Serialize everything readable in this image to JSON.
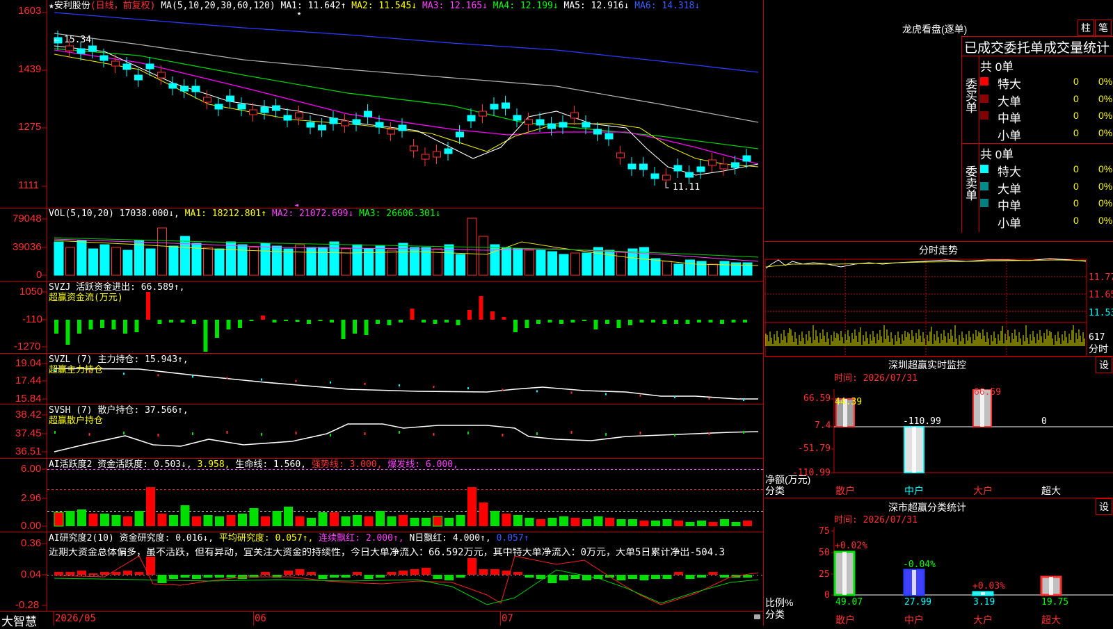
{
  "header": {
    "stock": "★安利股份",
    "period": "(日线，前复权)",
    "ma_params": "MA(5,10,20,30,60,120)",
    "ma1": "MA1: 11.642↑",
    "ma2": "MA2: 11.545↓",
    "ma3": "MA3: 12.165↓",
    "ma4": "MA4: 12.199↓",
    "ma5": "MA5: 12.916↓",
    "ma6": "MA6: 14.318↓"
  },
  "price_axis": [
    "1603",
    "1439",
    "1275",
    "1111"
  ],
  "price_annotations": {
    "high": "15.34",
    "low": "11.11"
  },
  "vol": {
    "name": "VOL(5,10,20)",
    "value": "17038.000↓,",
    "ma1": "MA1: 18212.801↑",
    "ma2": "MA2: 21072.699↓",
    "ma3": "MA3: 26606.301↓",
    "axis": [
      "79048",
      "39036",
      "0"
    ]
  },
  "svzj": {
    "title": "SVZJ  活跃资金进出: 66.589↑,",
    "subtitle": "超赢资金流(万元)",
    "axis": [
      "1050",
      "-110",
      "-1270"
    ]
  },
  "svzl": {
    "title": "SVZL (7) 主力持仓: 15.943↑,",
    "subtitle": "超赢主力持仓",
    "axis": [
      "19.04",
      "17.44",
      "15.84"
    ]
  },
  "svsh": {
    "title": "SVSH (7) 散户持仓: 37.566↑,",
    "subtitle": "超赢散户持仓",
    "axis": [
      "38.42",
      "37.45",
      "36.51"
    ]
  },
  "ai_active": {
    "name": "AI活跃度2 资金活跃度: 0.503↓,",
    "v2": "3.958,",
    "life": "生命线: 1.560,",
    "strong": "强势线: 3.000,",
    "burst": "爆发线: 6.000,",
    "axis": [
      "6.00",
      "2.96",
      "0.00"
    ]
  },
  "ai_research": {
    "name": "AI研究度2(10) 资金研究度: 0.016↓,",
    "avg": "平均研究度: 0.057↑,",
    "cont": "连续飘红: 2.000↑,",
    "nday": "N日飘红: 4.000↑,",
    "last": "0.057↑",
    "axis": [
      "0.36",
      "0.04",
      "-0.28"
    ],
    "comment": "近期大资金总体偏多，虽不活跃，但有异动，宜关注大资金的持续性，今日大单净流入：66.592万元，其中特大单净流入：0万元，大单5日累计净出-504.3"
  },
  "footer": {
    "brand": "大智慧",
    "dates": [
      "2026/05",
      "06",
      "07"
    ]
  },
  "right": {
    "dragon_title": "龙虎看盘(逐单)",
    "tab1": "柱",
    "tab2": "笔",
    "stat_title": "已成交委托单成交量统计",
    "buy_label": "委买单",
    "sell_label": "委卖单",
    "buy_total": "共 0单",
    "sell_total": "共 0单",
    "buy_rows": [
      {
        "name": "特大",
        "count": "0",
        "pct": "0%",
        "color": "#ff0000"
      },
      {
        "name": "大单",
        "count": "0",
        "pct": "0%",
        "color": "#8b0000"
      },
      {
        "name": "中单",
        "count": "0",
        "pct": "0%",
        "color": "#800000"
      },
      {
        "name": "小单",
        "count": "0",
        "pct": "0%",
        "color": "#000000"
      }
    ],
    "sell_rows": [
      {
        "name": "特大",
        "count": "0",
        "pct": "0%",
        "color": "#00ffff"
      },
      {
        "name": "大单",
        "count": "0",
        "pct": "0%",
        "color": "#008b8b"
      },
      {
        "name": "中单",
        "count": "0",
        "pct": "0%",
        "color": "#008080"
      },
      {
        "name": "小单",
        "count": "0",
        "pct": "0%",
        "color": "#000000"
      }
    ],
    "intraday_title": "分时走势",
    "intraday_axis": [
      "11.77",
      "11.65",
      "11.53"
    ],
    "intraday_vol": "617",
    "intraday_label": "分时",
    "monitor_title": "深圳超赢实时监控",
    "settings": "设",
    "monitor_time": "时间: 2026/07/31",
    "monitor_axis": [
      "66.59",
      "7.4",
      "-51.79",
      "-110.99"
    ],
    "monitor_values": [
      "44.39",
      "-110.99",
      "66.59",
      "0"
    ],
    "monitor_ylabel": "净额(万元)",
    "monitor_xlabel": "分类",
    "categories": [
      "散户",
      "中户",
      "大户",
      "超大"
    ],
    "class_title": "深市超赢分类统计",
    "class_time": "时间: 2026/07/31",
    "class_axis": [
      "75",
      "50",
      "25",
      "0"
    ],
    "class_changes": [
      "+0.02%",
      "-0.04%",
      "+0.03%",
      ""
    ],
    "class_values": [
      "49.07",
      "27.99",
      "3.19",
      "19.75"
    ],
    "class_ylabel": "比例%",
    "class_xlabel": "分类"
  }
}
